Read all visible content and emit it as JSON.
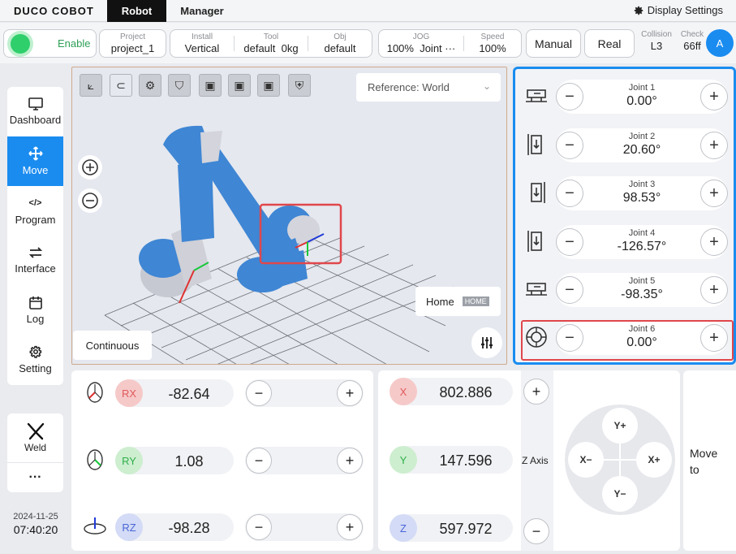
{
  "topbar": {
    "logo": "DUCO COBOT",
    "tabs": [
      "Robot",
      "Manager"
    ],
    "display_settings": "Display Settings"
  },
  "status": {
    "enable": "Enable",
    "project": {
      "label": "Project",
      "value": "project_1"
    },
    "install": {
      "label": "Install",
      "value": "Vertical"
    },
    "tool": {
      "label": "Tool",
      "value": "default",
      "mass": "0kg"
    },
    "obj": {
      "label": "Obj",
      "value": "default"
    },
    "jog": {
      "label": "JOG",
      "value": "100%",
      "mode": "Joint ···"
    },
    "speed": {
      "label": "Speed",
      "value": "100%"
    },
    "manual": "Manual",
    "real": "Real",
    "collision": {
      "label": "Collision",
      "value": "L3"
    },
    "check": {
      "label": "Check",
      "value": "66ff"
    },
    "avatar": "A"
  },
  "sidebar": {
    "items": [
      {
        "label": "Dashboard",
        "icon": "monitor-icon"
      },
      {
        "label": "Move",
        "icon": "move-arrows-icon"
      },
      {
        "label": "Program",
        "icon": "code-icon"
      },
      {
        "label": "Interface",
        "icon": "swap-icon"
      },
      {
        "label": "Log",
        "icon": "calendar-icon"
      },
      {
        "label": "Setting",
        "icon": "gear-icon"
      }
    ],
    "weld": "Weld",
    "more": "···",
    "date": "2024-11-25",
    "time": "07:40:20"
  },
  "viewport": {
    "reference": "Reference: World",
    "home": "Home",
    "home_tag": "HOME",
    "continuous": "Continuous"
  },
  "joints": [
    {
      "name": "Joint 1",
      "value": "0.00°"
    },
    {
      "name": "Joint 2",
      "value": "20.60°"
    },
    {
      "name": "Joint 3",
      "value": "98.53°"
    },
    {
      "name": "Joint 4",
      "value": "-126.57°"
    },
    {
      "name": "Joint 5",
      "value": "-98.35°"
    },
    {
      "name": "Joint 6",
      "value": "0.00°"
    }
  ],
  "rotation": [
    {
      "axis": "RX",
      "value": "-82.64",
      "color": "#f6c9c9",
      "text": "#e05a5a"
    },
    {
      "axis": "RY",
      "value": "1.08",
      "color": "#cdeecf",
      "text": "#2fae4a"
    },
    {
      "axis": "RZ",
      "value": "-98.28",
      "color": "#d3dbf6",
      "text": "#4a66d6"
    }
  ],
  "position": [
    {
      "axis": "X",
      "value": "802.886",
      "color": "#f6c9c9",
      "text": "#e05a5a"
    },
    {
      "axis": "Y",
      "value": "147.596",
      "color": "#cdeecf",
      "text": "#2fae4a"
    },
    {
      "axis": "Z",
      "value": "597.972",
      "color": "#d3dbf6",
      "text": "#4a66d6"
    }
  ],
  "zaxis": "Z Axis",
  "pad": {
    "yplus": "Y+",
    "yminus": "Y−",
    "xminus": "X−",
    "xplus": "X+"
  },
  "moveto": {
    "line1": "Move",
    "line2": "to"
  },
  "symbols": {
    "minus": "−",
    "plus": "+"
  }
}
